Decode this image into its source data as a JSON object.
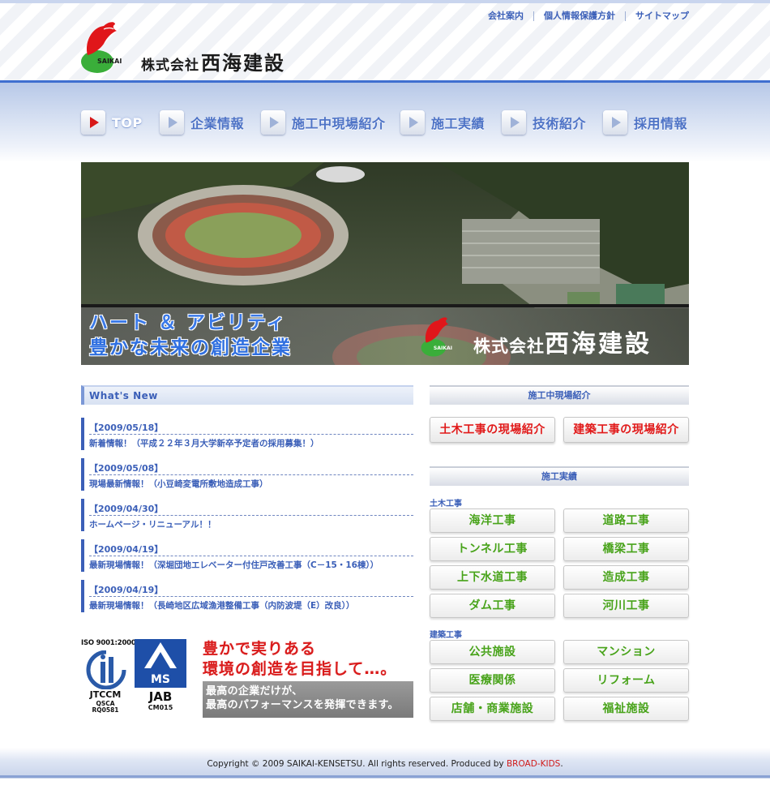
{
  "header": {
    "logo_text": "SAIKAI",
    "company_prefix": "株式会社",
    "company_name": "西海建設",
    "links": [
      "会社案内",
      "個人情報保護方針",
      "サイトマップ"
    ]
  },
  "nav": {
    "items": [
      {
        "label": "TOP",
        "active": true
      },
      {
        "label": "企業情報",
        "active": false
      },
      {
        "label": "施工中現場紹介",
        "active": false
      },
      {
        "label": "施工実績",
        "active": false
      },
      {
        "label": "技術紹介",
        "active": false
      },
      {
        "label": "採用情報",
        "active": false
      }
    ]
  },
  "hero": {
    "slogan_line1": "ハート ＆ アビリティ",
    "slogan_line2": "豊かな未来の創造企業",
    "logo_text": "SAIKAI",
    "company_prefix": "株式会社",
    "company_name": "西海建設"
  },
  "news": {
    "heading": "What's New",
    "items": [
      {
        "date": "【2009/05/18】",
        "title": "新着情報！（平成２２年３月大学新卒予定者の採用募集！）"
      },
      {
        "date": "【2009/05/08】",
        "title": "現場最新情報！（小豆崎変電所敷地造成工事）"
      },
      {
        "date": "【2009/04/30】",
        "title": "ホームページ・リニューアル！！"
      },
      {
        "date": "【2009/04/19】",
        "title": "最新現場情報！（深堀団地エレベーター付住戸改善工事（C－15・16棟））"
      },
      {
        "date": "【2009/04/19】",
        "title": "最新現場情報！（長崎地区広域漁港整備工事（内防波堤（E）改良））"
      }
    ]
  },
  "certs": {
    "iso_label": "ISO 9001:2000",
    "jtccm": "JTCCM",
    "qsca": "QSCA",
    "rq": "RQ0581",
    "jab": "JAB",
    "cm": "CM015",
    "ms": "MS"
  },
  "motto": {
    "line1": "豊かで実りある",
    "line2": "環境の創造を目指して…。",
    "sub1": "最高の企業だけが、",
    "sub2": "最高のパフォーマンスを発揮できます。"
  },
  "sites": {
    "heading": "施工中現場紹介",
    "buttons": [
      "土木工事の現場紹介",
      "建築工事の現場紹介"
    ]
  },
  "results": {
    "heading": "施工実績",
    "civil_label": "土木工事",
    "civil": [
      "海洋工事",
      "道路工事",
      "トンネル工事",
      "橋梁工事",
      "上下水道工事",
      "造成工事",
      "ダム工事",
      "河川工事"
    ],
    "building_label": "建築工事",
    "building": [
      "公共施設",
      "マンション",
      "医療関係",
      "リフォーム",
      "店舗・商業施設",
      "福祉施設"
    ]
  },
  "footer": {
    "copyright": "Copyright © 2009 SAIKAI-KENSETSU. All rights reserved. Produced by ",
    "producer": "BROAD-KIDS",
    "period": "."
  },
  "colors": {
    "primary_blue": "#3b5fb8",
    "accent_red": "#e11a1a",
    "accent_green": "#48a31a"
  }
}
